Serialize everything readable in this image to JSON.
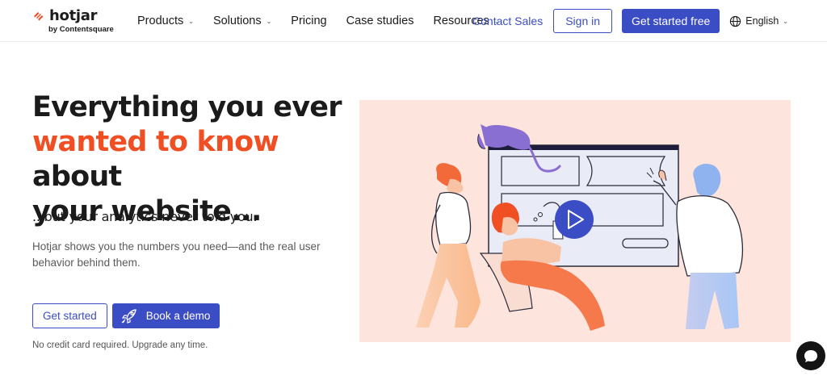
{
  "brand": {
    "name": "hotjar",
    "tagline": "by Contentsquare",
    "accent_color": "#f04e23",
    "primary_color": "#3b4dc4"
  },
  "nav": {
    "items": [
      {
        "label": "Products",
        "has_dropdown": true
      },
      {
        "label": "Solutions",
        "has_dropdown": true
      },
      {
        "label": "Pricing",
        "has_dropdown": false
      },
      {
        "label": "Case studies",
        "has_dropdown": false
      },
      {
        "label": "Resources",
        "has_dropdown": true
      }
    ],
    "contact_sales": "Contact Sales",
    "sign_in": "Sign in",
    "get_started_free": "Get started free",
    "language": "English",
    "language_icon": "globe-icon",
    "dropdown_icon": "chevron-down-icon"
  },
  "hero": {
    "title_line1": "Everything you ever",
    "title_accent": "wanted to know",
    "title_line2_rest": " about",
    "title_line3": "your website...",
    "subtitle": "...but your analytics never told you.",
    "description": "Hotjar shows you the numbers you need—and the real user behavior behind them.",
    "cta_get_started": "Get started",
    "cta_book_demo": "Book a demo",
    "cta_book_demo_icon": "rocket-icon",
    "note": "No credit card required. Upgrade any time."
  },
  "illustration": {
    "play_icon": "play-icon",
    "background": "#fde4dc"
  },
  "chat_widget": {
    "icon": "chat-bubble-icon"
  }
}
